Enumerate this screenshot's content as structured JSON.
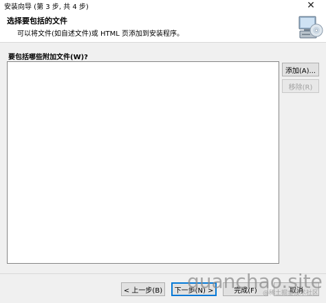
{
  "window": {
    "title": "安装向导 (第 3 步, 共 4 步)",
    "close_glyph": "✕"
  },
  "header": {
    "title": "选择要包括的文件",
    "description": "可以将文件(如自述文件)或 HTML 页添加到安装程序。",
    "icon": "computer-cd-icon"
  },
  "main": {
    "prompt": "要包括哪些附加文件(W)?",
    "files": []
  },
  "buttons": {
    "add": "添加(A)...",
    "remove": "移除(R)",
    "back": "< 上一步(B)",
    "next": "下一步(N) >",
    "finish": "完成(F)",
    "cancel": "取消"
  },
  "watermark": {
    "text": "guanchao.site",
    "subtext": "@稀土掘金技术社区"
  }
}
